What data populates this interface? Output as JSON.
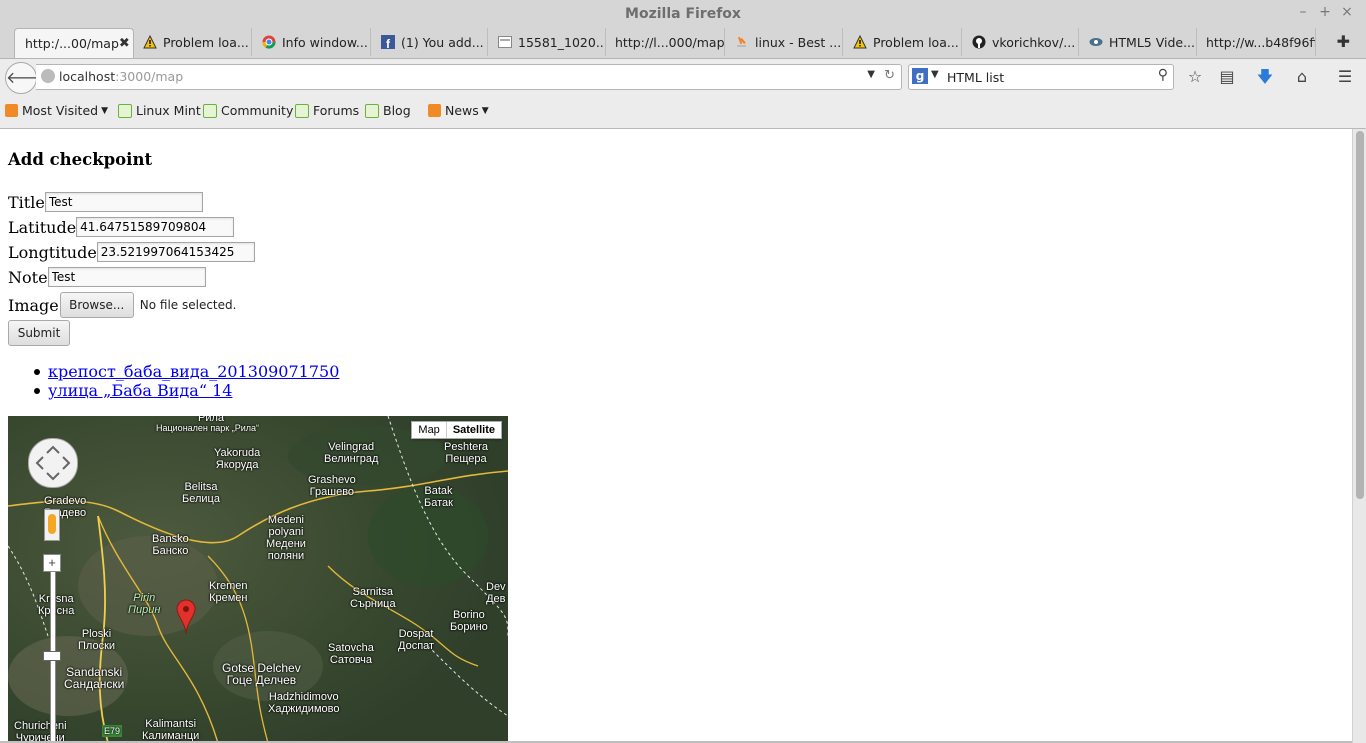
{
  "window": {
    "title": "Mozilla Firefox"
  },
  "tabs": [
    {
      "label": "http:/...00/map",
      "icon": "blank-page-icon",
      "active": true
    },
    {
      "label": "Problem loa...",
      "icon": "warning-icon"
    },
    {
      "label": "Info window...",
      "icon": "chrome-icon"
    },
    {
      "label": "(1) You add...",
      "icon": "facebook-icon"
    },
    {
      "label": "15581_1020...",
      "icon": "image-icon"
    },
    {
      "label": "http://l...000/map",
      "icon": "blank-page-icon"
    },
    {
      "label": "linux - Best ...",
      "icon": "stackoverflow-icon"
    },
    {
      "label": "Problem loa...",
      "icon": "warning-icon"
    },
    {
      "label": "vkorichkov/...",
      "icon": "github-icon"
    },
    {
      "label": "HTML5 Vide...",
      "icon": "eye-icon"
    },
    {
      "label": "http://w...b48f96ff",
      "icon": "blank-page-icon"
    }
  ],
  "nav": {
    "url_host": "localhost",
    "url_rest": ":3000/map",
    "search_value": "HTML list"
  },
  "bookmarks": [
    {
      "label": "Most Visited",
      "dropdown": true
    },
    {
      "label": "Linux Mint"
    },
    {
      "label": "Community"
    },
    {
      "label": "Forums"
    },
    {
      "label": "Blog"
    },
    {
      "label": "News",
      "dropdown": true
    }
  ],
  "form": {
    "heading": "Add checkpoint",
    "title_label": "Title",
    "title_value": "Test",
    "lat_label": "Latitude",
    "lat_value": "41.64751589709804",
    "lng_label": "Longtitude",
    "lng_value": "23.521997064153425",
    "note_label": "Note",
    "note_value": "Test",
    "image_label": "Image",
    "browse_label": "Browse...",
    "file_status": "No file selected.",
    "submit_label": "Submit"
  },
  "links": [
    "крепост_баба_вида_201309071750",
    "улица „Баба Вида“ 14"
  ],
  "map": {
    "type_map": "Map",
    "type_satellite": "Satellite",
    "places": [
      "Рила",
      "Национален парк „Рила“",
      "Yakoruda",
      "Якоруда",
      "Velingrad",
      "Велинград",
      "Peshtera",
      "Пещера",
      "Gradevo",
      "Градево",
      "Belitsa",
      "Белица",
      "Grashevo",
      "Грашево",
      "Batak",
      "Батак",
      "Medeni",
      "polyani",
      "Медени",
      "поляни",
      "Bansko",
      "Банско",
      "Kremen",
      "Кремен",
      "Pirin",
      "Пирин",
      "Kresna",
      "Кресна",
      "Sarnitsa",
      "Сърница",
      "Dev",
      "Дев",
      "Borino",
      "Борино",
      "Ploski",
      "Плоски",
      "Dospat",
      "Доспат",
      "Satovcha",
      "Сатовча",
      "Sandanski",
      "Сандански",
      "Gotse Delchev",
      "Гоце Делчев",
      "Hadzhidimovo",
      "Хаджидимово",
      "Churicheni",
      "Чуричени",
      "Kalimantsi",
      "Калиманци",
      "E79"
    ]
  }
}
